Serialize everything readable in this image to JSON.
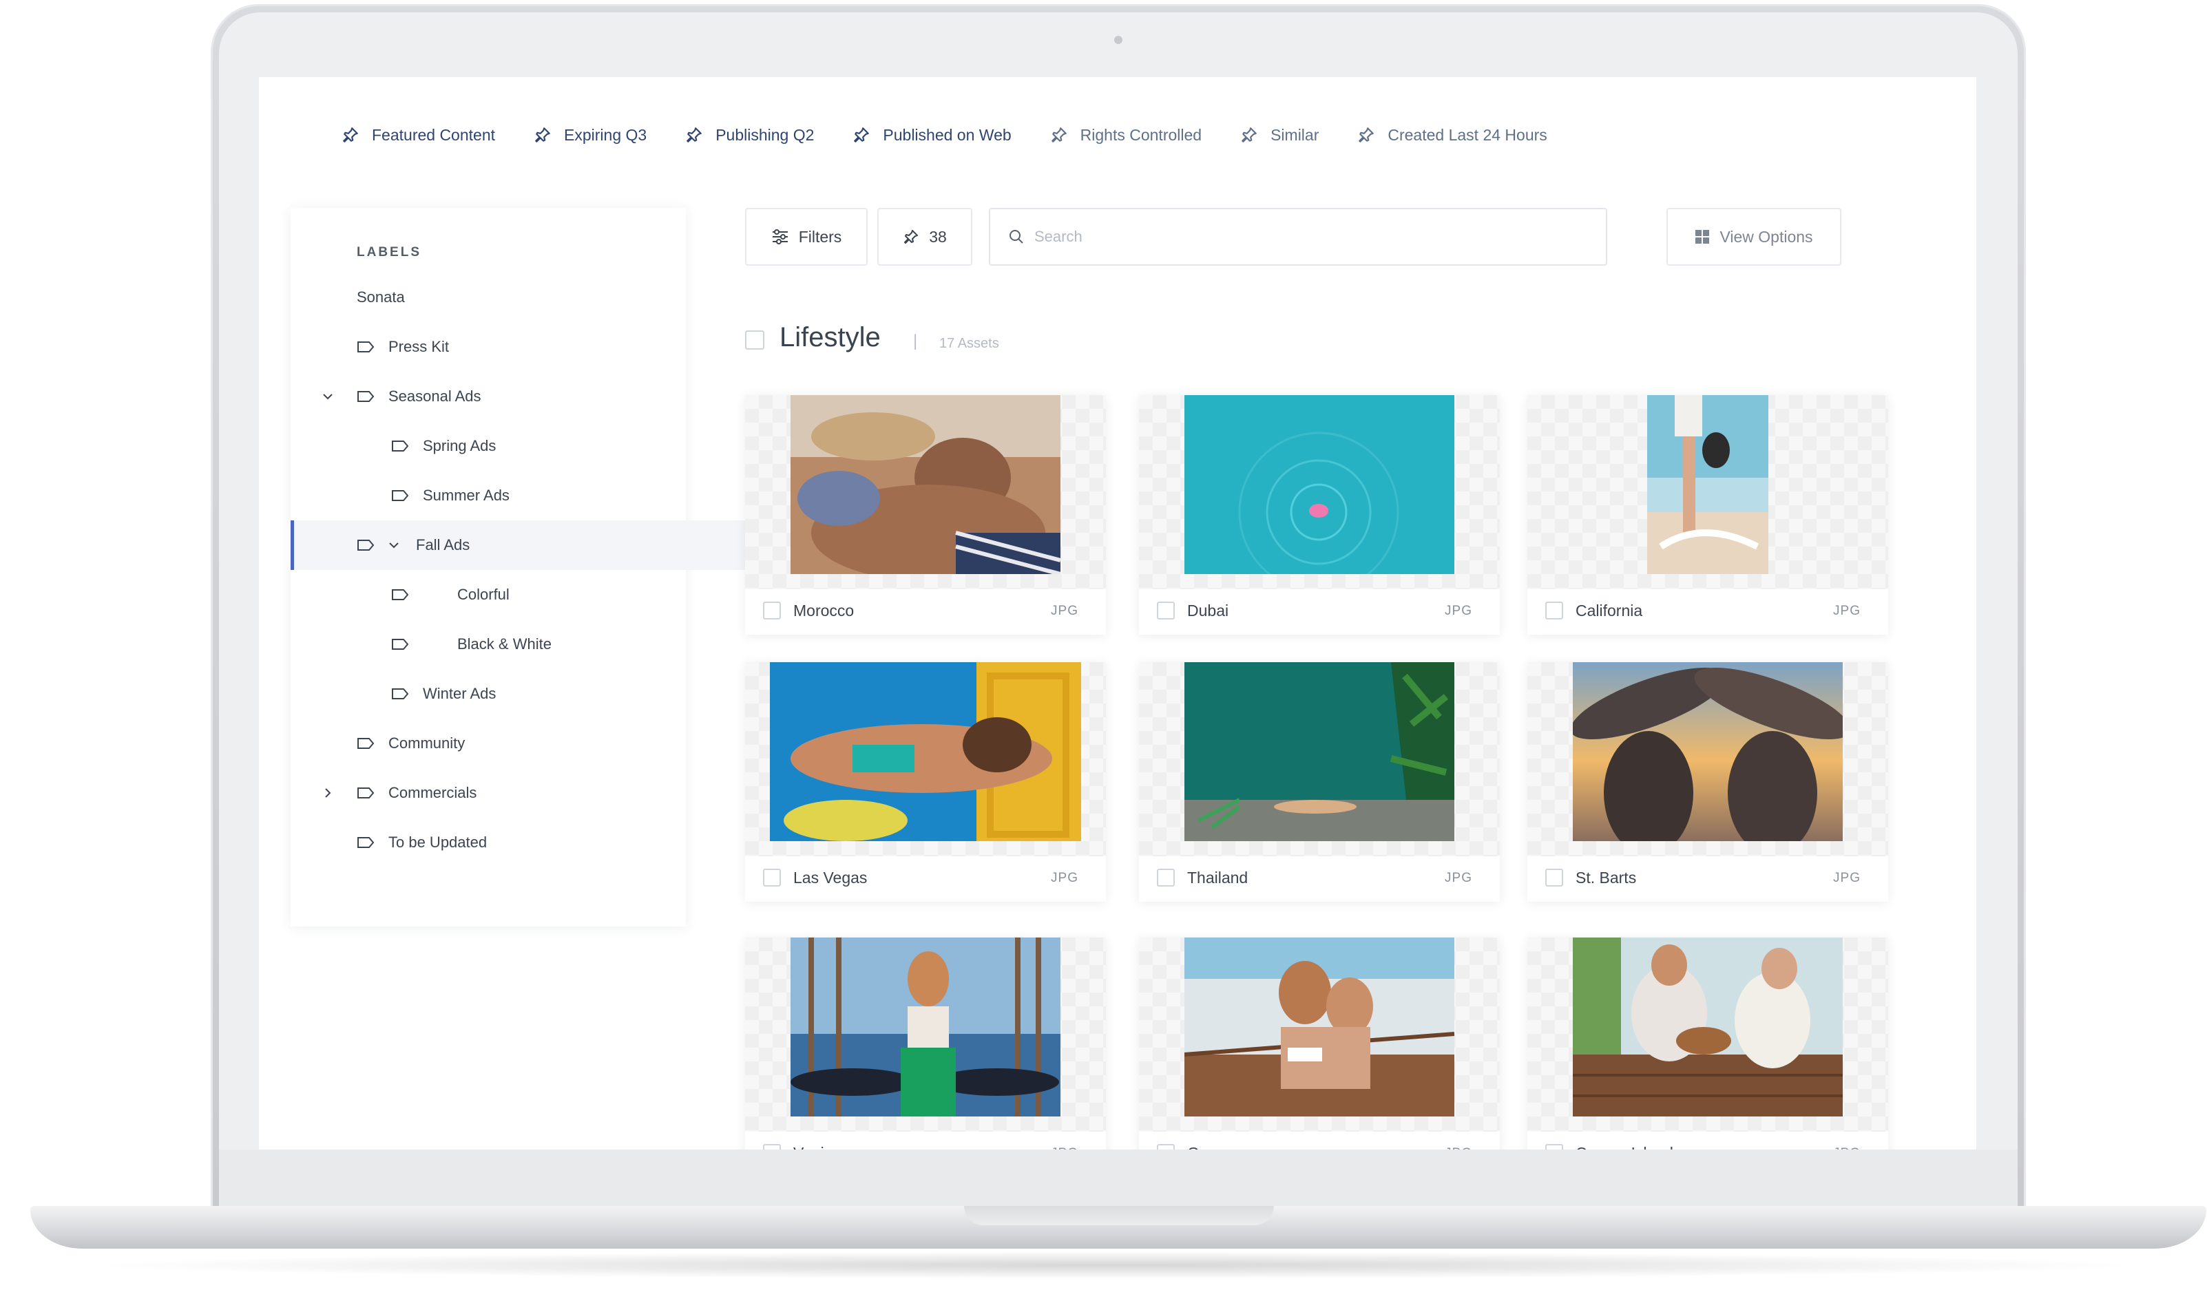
{
  "pinned_searches": [
    {
      "label": "Featured Content"
    },
    {
      "label": "Expiring Q3"
    },
    {
      "label": "Publishing Q2"
    },
    {
      "label": "Published on Web"
    },
    {
      "label": "Rights Controlled"
    },
    {
      "label": "Similar"
    },
    {
      "label": "Created Last 24 Hours"
    }
  ],
  "sidebar": {
    "heading": "LABELS",
    "root": "Sonata",
    "items": [
      {
        "label": "Press Kit"
      },
      {
        "label": "Seasonal Ads"
      },
      {
        "label": "Spring Ads"
      },
      {
        "label": "Summer Ads"
      },
      {
        "label": "Fall Ads"
      },
      {
        "label": "Colorful"
      },
      {
        "label": "Black & White"
      },
      {
        "label": "Winter Ads"
      },
      {
        "label": "Community"
      },
      {
        "label": "Commercials"
      },
      {
        "label": "To be Updated"
      }
    ]
  },
  "toolbar": {
    "filters_label": "Filters",
    "pinned_count": "38",
    "search_placeholder": "Search",
    "view_options_label": "View Options"
  },
  "section": {
    "title": "Lifestyle",
    "separator": "|",
    "count": "17 Assets"
  },
  "assets": [
    {
      "name": "Morocco",
      "type": "JPG"
    },
    {
      "name": "Dubai",
      "type": "JPG"
    },
    {
      "name": "California",
      "type": "JPG"
    },
    {
      "name": "Las Vegas",
      "type": "JPG"
    },
    {
      "name": "Thailand",
      "type": "JPG"
    },
    {
      "name": "St. Barts",
      "type": "JPG"
    },
    {
      "name": "Venice",
      "type": "JPG"
    },
    {
      "name": "Greece",
      "type": "JPG"
    },
    {
      "name": "Canary Islands",
      "type": "JPG"
    }
  ],
  "colors": {
    "accent": "#4a65c0",
    "pin_text": "#2f4470",
    "text": "#3c4450",
    "border": "#e7e9ee"
  }
}
